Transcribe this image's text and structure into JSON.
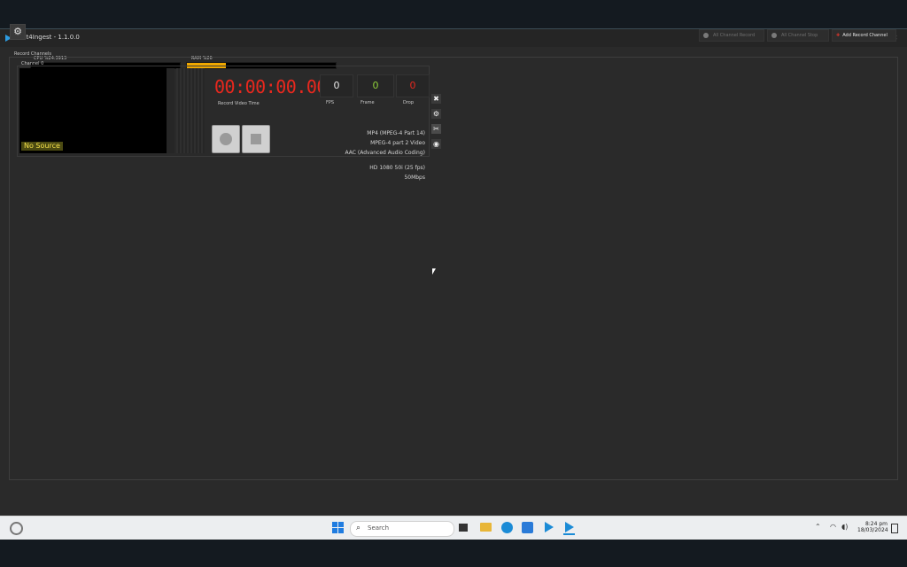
{
  "window": {
    "title": "Next4Ingest - 1.1.0.0",
    "controls": {
      "minimize": "▬",
      "maximize": "□",
      "close": "✕"
    }
  },
  "meters": {
    "cpu": {
      "label": "CPU %24.3913",
      "fraction": 0.0
    },
    "ram": {
      "label": "RAM %26",
      "fraction": 0.26
    }
  },
  "toolbar": {
    "all_record": "All Channel Record",
    "all_stop": "All Channel Stop",
    "add_channel": "Add Record Channel"
  },
  "channels_group": {
    "label": "Record Channels",
    "channel": {
      "name": "Channel 0",
      "preview_status": "No Source",
      "record_time_label": "Record Video Time",
      "record_time": "00:00:00.00",
      "fps_label": "FPS",
      "fps": "0",
      "frame_label": "Frame",
      "frame": "0",
      "drop_label": "Drop",
      "drop": "0",
      "container": "MP4 (MPEG-4 Part 14)",
      "video_codec": "MPEG-4 part 2 Video",
      "audio_codec": "AAC (Advanced Audio Coding)",
      "resolution": "HD 1080 50i (25 fps)",
      "bitrate": "50Mbps"
    }
  },
  "taskbar": {
    "search_placeholder": "Search",
    "time": "8:24 pm",
    "date": "18/03/2024"
  },
  "colors": {
    "accent_ram": "#f0a800",
    "timecode": "#e8281e",
    "frame_value": "#8fcf3a",
    "drop_value": "#e8281e",
    "add_icon": "#e0352b"
  },
  "icons": [
    "gear-icon",
    "record-dot-icon",
    "stop-dot-icon",
    "add-icon",
    "close-icon",
    "camera-settings-icon",
    "cut-icon",
    "eye-icon",
    "windows-start-icon",
    "search-icon",
    "task-view-icon",
    "file-explorer-icon",
    "edge-icon",
    "store-icon",
    "app-icon",
    "wifi-icon",
    "volume-icon",
    "battery-icon"
  ]
}
